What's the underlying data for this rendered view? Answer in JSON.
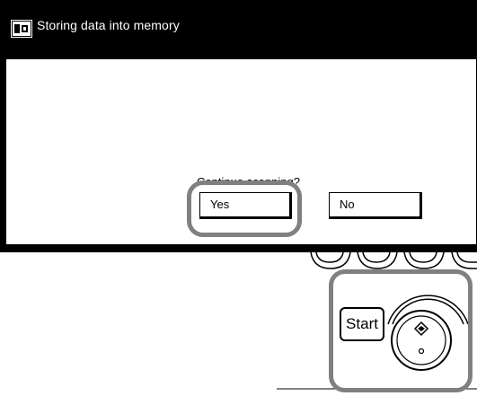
{
  "window": {
    "title": "Storing data into memory",
    "title_icon": "copier-icon"
  },
  "dialog": {
    "prompt": "Continue scanning?",
    "buttons": {
      "yes": "Yes",
      "no": "No"
    }
  },
  "panel": {
    "start_label": "Start"
  },
  "colors": {
    "titlebar": "#000000",
    "highlight": "#808080",
    "background": "#ffffff"
  }
}
